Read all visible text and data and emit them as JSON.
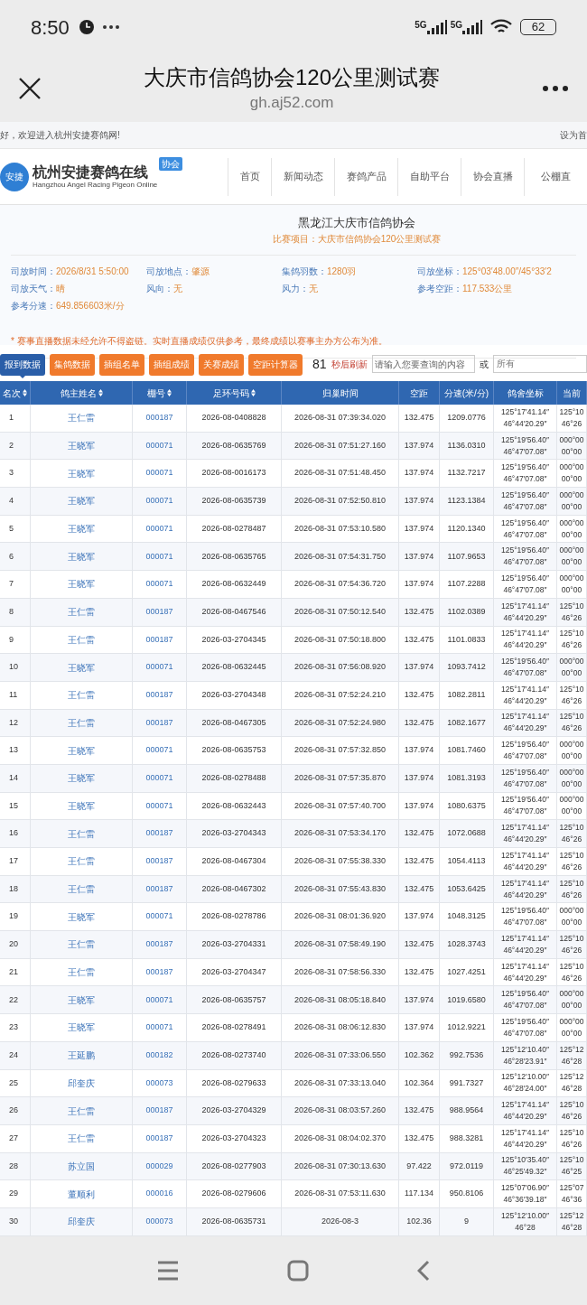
{
  "status_bar": {
    "time": "8:50",
    "network_1": "5G",
    "network_2": "5G",
    "battery": "62"
  },
  "browser": {
    "title": "大庆市信鸽协会120公里测试赛",
    "url": "gh.aj52.com"
  },
  "top_bar": {
    "welcome": "好，欢迎进入杭州安捷赛鸽网!",
    "link": "设为首"
  },
  "logo": {
    "mark": "安捷",
    "name": "杭州安捷赛鸽在线",
    "subtitle": "Hangzhou Angel Racing Pigeon Online",
    "badge": "协会"
  },
  "nav": [
    "首页",
    "新闻动态",
    "赛鸽产品",
    "自助平台",
    "协会直播",
    "公棚直"
  ],
  "race": {
    "organizer": "黑龙江大庆市信鸽协会",
    "event": "比赛项目：大庆市信鸽协会120公里测试赛",
    "fields": [
      {
        "label": "司放时间：",
        "value": "2026/8/31 5:50:00"
      },
      {
        "label": "司放地点：",
        "value": "肇源"
      },
      {
        "label": "集鸽羽数：",
        "value": "1280羽"
      },
      {
        "label": "司放坐标：",
        "value": "125°03′48.00″/45°33′2"
      },
      {
        "label": "司放天气：",
        "value": "晴"
      },
      {
        "label": "风向：",
        "value": "无"
      },
      {
        "label": "风力：",
        "value": "无"
      },
      {
        "label": "参考空距：",
        "value": "117.533公里"
      },
      {
        "label": "参考分速：",
        "value": "649.856603米/分"
      }
    ],
    "notice": "* 赛事直播数据未经允许不得盗链。实时直播成绩仅供参考，最终成绩以赛事主办方公布为准。"
  },
  "toolbar": {
    "buttons": [
      {
        "label": "报到数据",
        "selected": true
      },
      {
        "label": "集鸽数据",
        "selected": false
      },
      {
        "label": "插组名单",
        "selected": false
      },
      {
        "label": "插组成绩",
        "selected": false
      },
      {
        "label": "关赛成绩",
        "selected": false
      },
      {
        "label": "空距计算器",
        "selected": false
      }
    ],
    "countdown": "81",
    "countdown_label": "秒后刷新",
    "search": {
      "placeholder": "请输入您要查询的内容"
    },
    "or_label": "或",
    "filter": "所有"
  },
  "table": {
    "columns": [
      {
        "label": "名次",
        "sortable": true
      },
      {
        "label": "鸽主姓名",
        "sortable": true
      },
      {
        "label": "棚号",
        "sortable": true
      },
      {
        "label": "足环号码",
        "sortable": true
      },
      {
        "label": "归巢时间",
        "sortable": false
      },
      {
        "label": "空距",
        "sortable": false
      },
      {
        "label": "分速(米/分)",
        "sortable": false
      },
      {
        "label": "鸽舍坐标",
        "sortable": false
      },
      {
        "label": "当前",
        "sortable": false
      }
    ],
    "rows": [
      [
        "1",
        "王仁雷",
        "000187",
        "2026-08-0408828",
        "2026-08-31 07:39:34.020",
        "132.475",
        "1209.0776",
        [
          "125°17′41.14″",
          "46°44′20.29″"
        ],
        [
          "125°10",
          "46°26"
        ]
      ],
      [
        "2",
        "王晓军",
        "000071",
        "2026-08-0635769",
        "2026-08-31 07:51:27.160",
        "137.974",
        "1136.0310",
        [
          "125°19′56.40″",
          "46°47′07.08″"
        ],
        [
          "000°00",
          "00°00"
        ]
      ],
      [
        "3",
        "王晓军",
        "000071",
        "2026-08-0016173",
        "2026-08-31 07:51:48.450",
        "137.974",
        "1132.7217",
        [
          "125°19′56.40″",
          "46°47′07.08″"
        ],
        [
          "000°00",
          "00°00"
        ]
      ],
      [
        "4",
        "王晓军",
        "000071",
        "2026-08-0635739",
        "2026-08-31 07:52:50.810",
        "137.974",
        "1123.1384",
        [
          "125°19′56.40″",
          "46°47′07.08″"
        ],
        [
          "000°00",
          "00°00"
        ]
      ],
      [
        "5",
        "王晓军",
        "000071",
        "2026-08-0278487",
        "2026-08-31 07:53:10.580",
        "137.974",
        "1120.1340",
        [
          "125°19′56.40″",
          "46°47′07.08″"
        ],
        [
          "000°00",
          "00°00"
        ]
      ],
      [
        "6",
        "王晓军",
        "000071",
        "2026-08-0635765",
        "2026-08-31 07:54:31.750",
        "137.974",
        "1107.9653",
        [
          "125°19′56.40″",
          "46°47′07.08″"
        ],
        [
          "000°00",
          "00°00"
        ]
      ],
      [
        "7",
        "王晓军",
        "000071",
        "2026-08-0632449",
        "2026-08-31 07:54:36.720",
        "137.974",
        "1107.2288",
        [
          "125°19′56.40″",
          "46°47′07.08″"
        ],
        [
          "000°00",
          "00°00"
        ]
      ],
      [
        "8",
        "王仁雷",
        "000187",
        "2026-08-0467546",
        "2026-08-31 07:50:12.540",
        "132.475",
        "1102.0389",
        [
          "125°17′41.14″",
          "46°44′20.29″"
        ],
        [
          "125°10",
          "46°26"
        ]
      ],
      [
        "9",
        "王仁雷",
        "000187",
        "2026-03-2704345",
        "2026-08-31 07:50:18.800",
        "132.475",
        "1101.0833",
        [
          "125°17′41.14″",
          "46°44′20.29″"
        ],
        [
          "125°10",
          "46°26"
        ]
      ],
      [
        "10",
        "王晓军",
        "000071",
        "2026-08-0632445",
        "2026-08-31 07:56:08.920",
        "137.974",
        "1093.7412",
        [
          "125°19′56.40″",
          "46°47′07.08″"
        ],
        [
          "000°00",
          "00°00"
        ]
      ],
      [
        "11",
        "王仁雷",
        "000187",
        "2026-03-2704348",
        "2026-08-31 07:52:24.210",
        "132.475",
        "1082.2811",
        [
          "125°17′41.14″",
          "46°44′20.29″"
        ],
        [
          "125°10",
          "46°26"
        ]
      ],
      [
        "12",
        "王仁雷",
        "000187",
        "2026-08-0467305",
        "2026-08-31 07:52:24.980",
        "132.475",
        "1082.1677",
        [
          "125°17′41.14″",
          "46°44′20.29″"
        ],
        [
          "125°10",
          "46°26"
        ]
      ],
      [
        "13",
        "王晓军",
        "000071",
        "2026-08-0635753",
        "2026-08-31 07:57:32.850",
        "137.974",
        "1081.7460",
        [
          "125°19′56.40″",
          "46°47′07.08″"
        ],
        [
          "000°00",
          "00°00"
        ]
      ],
      [
        "14",
        "王晓军",
        "000071",
        "2026-08-0278488",
        "2026-08-31 07:57:35.870",
        "137.974",
        "1081.3193",
        [
          "125°19′56.40″",
          "46°47′07.08″"
        ],
        [
          "000°00",
          "00°00"
        ]
      ],
      [
        "15",
        "王晓军",
        "000071",
        "2026-08-0632443",
        "2026-08-31 07:57:40.700",
        "137.974",
        "1080.6375",
        [
          "125°19′56.40″",
          "46°47′07.08″"
        ],
        [
          "000°00",
          "00°00"
        ]
      ],
      [
        "16",
        "王仁雷",
        "000187",
        "2026-03-2704343",
        "2026-08-31 07:53:34.170",
        "132.475",
        "1072.0688",
        [
          "125°17′41.14″",
          "46°44′20.29″"
        ],
        [
          "125°10",
          "46°26"
        ]
      ],
      [
        "17",
        "王仁雷",
        "000187",
        "2026-08-0467304",
        "2026-08-31 07:55:38.330",
        "132.475",
        "1054.4113",
        [
          "125°17′41.14″",
          "46°44′20.29″"
        ],
        [
          "125°10",
          "46°26"
        ]
      ],
      [
        "18",
        "王仁雷",
        "000187",
        "2026-08-0467302",
        "2026-08-31 07:55:43.830",
        "132.475",
        "1053.6425",
        [
          "125°17′41.14″",
          "46°44′20.29″"
        ],
        [
          "125°10",
          "46°26"
        ]
      ],
      [
        "19",
        "王晓军",
        "000071",
        "2026-08-0278786",
        "2026-08-31 08:01:36.920",
        "137.974",
        "1048.3125",
        [
          "125°19′56.40″",
          "46°47′07.08″"
        ],
        [
          "000°00",
          "00°00"
        ]
      ],
      [
        "20",
        "王仁雷",
        "000187",
        "2026-03-2704331",
        "2026-08-31 07:58:49.190",
        "132.475",
        "1028.3743",
        [
          "125°17′41.14″",
          "46°44′20.29″"
        ],
        [
          "125°10",
          "46°26"
        ]
      ],
      [
        "21",
        "王仁雷",
        "000187",
        "2026-03-2704347",
        "2026-08-31 07:58:56.330",
        "132.475",
        "1027.4251",
        [
          "125°17′41.14″",
          "46°44′20.29″"
        ],
        [
          "125°10",
          "46°26"
        ]
      ],
      [
        "22",
        "王晓军",
        "000071",
        "2026-08-0635757",
        "2026-08-31 08:05:18.840",
        "137.974",
        "1019.6580",
        [
          "125°19′56.40″",
          "46°47′07.08″"
        ],
        [
          "000°00",
          "00°00"
        ]
      ],
      [
        "23",
        "王晓军",
        "000071",
        "2026-08-0278491",
        "2026-08-31 08:06:12.830",
        "137.974",
        "1012.9221",
        [
          "125°19′56.40″",
          "46°47′07.08″"
        ],
        [
          "000°00",
          "00°00"
        ]
      ],
      [
        "24",
        "王延鹏",
        "000182",
        "2026-08-0273740",
        "2026-08-31 07:33:06.550",
        "102.362",
        "992.7536",
        [
          "125°12′10.40″",
          "46°28′23.91″"
        ],
        [
          "125°12",
          "46°28"
        ]
      ],
      [
        "25",
        "邱奎庆",
        "000073",
        "2026-08-0279633",
        "2026-08-31 07:33:13.040",
        "102.364",
        "991.7327",
        [
          "125°12′10.00″",
          "46°28′24.00″"
        ],
        [
          "125°12",
          "46°28"
        ]
      ],
      [
        "26",
        "王仁雷",
        "000187",
        "2026-03-2704329",
        "2026-08-31 08:03:57.260",
        "132.475",
        "988.9564",
        [
          "125°17′41.14″",
          "46°44′20.29″"
        ],
        [
          "125°10",
          "46°26"
        ]
      ],
      [
        "27",
        "王仁雷",
        "000187",
        "2026-03-2704323",
        "2026-08-31 08:04:02.370",
        "132.475",
        "988.3281",
        [
          "125°17′41.14″",
          "46°44′20.29″"
        ],
        [
          "125°10",
          "46°26"
        ]
      ],
      [
        "28",
        "苏立国",
        "000029",
        "2026-08-0277903",
        "2026-08-31 07:30:13.630",
        "97.422",
        "972.0119",
        [
          "125°10′35.40″",
          "46°25′49.32″"
        ],
        [
          "125°10",
          "46°25"
        ]
      ],
      [
        "29",
        "董顺利",
        "000016",
        "2026-08-0279606",
        "2026-08-31 07:53:11.630",
        "117.134",
        "950.8106",
        [
          "125°07′06.90″",
          "46°36′39.18″"
        ],
        [
          "125°07",
          "46°36"
        ]
      ],
      [
        "30",
        "邱奎庆",
        "000073",
        "2026-08-0635731",
        "2026-08-3",
        "102.36",
        "9",
        [
          "125°12′10.00″",
          "46°28"
        ],
        [
          "125°12",
          "46°28"
        ]
      ]
    ]
  }
}
